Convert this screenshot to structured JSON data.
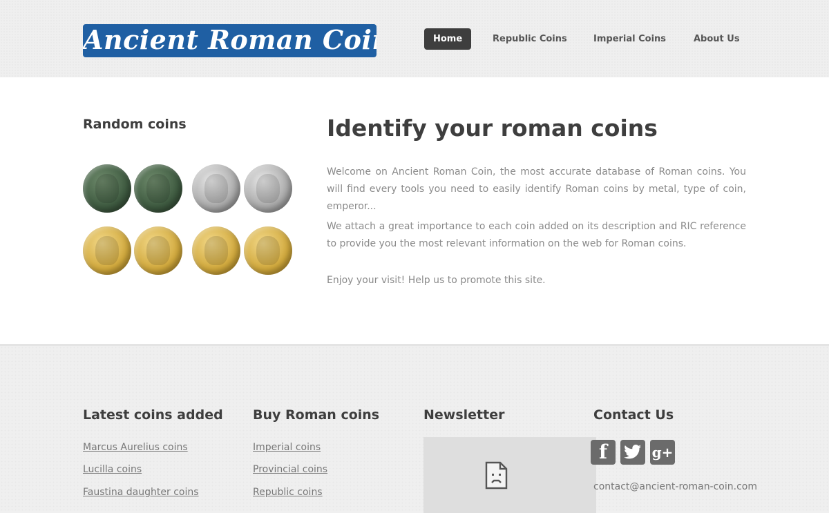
{
  "header": {
    "logo_text": "Ancient Roman Coin",
    "nav": [
      {
        "label": "Home",
        "active": true
      },
      {
        "label": "Republic Coins",
        "active": false
      },
      {
        "label": "Imperial Coins",
        "active": false
      },
      {
        "label": "About Us",
        "active": false
      }
    ]
  },
  "sidebar": {
    "title": "Random coins",
    "coins": [
      {
        "metal": "bronze"
      },
      {
        "metal": "bronze"
      },
      {
        "metal": "silver"
      },
      {
        "metal": "silver"
      },
      {
        "metal": "gold"
      },
      {
        "metal": "gold"
      },
      {
        "metal": "gold"
      },
      {
        "metal": "gold"
      }
    ]
  },
  "content": {
    "title": "Identify your roman coins",
    "paragraphs": [
      "Welcome on Ancient Roman Coin, the most accurate database of Roman coins. You will find every tools you need to easily identify Roman coins by metal, type of coin, emperor...",
      "We attach a great importance to each coin added on its description and RIC reference to provide you the most relevant information on the web for Roman coins.",
      "Enjoy your visit! Help us to promote this site."
    ]
  },
  "footer": {
    "latest": {
      "title": "Latest coins added",
      "links": [
        "Marcus Aurelius coins",
        "Lucilla coins",
        "Faustina daughter coins"
      ]
    },
    "buy": {
      "title": "Buy Roman coins",
      "links": [
        "Imperial coins",
        "Provincial coins",
        "Republic coins"
      ]
    },
    "newsletter": {
      "title": "Newsletter",
      "frame_icon": "broken-document-icon"
    },
    "contact": {
      "title": "Contact Us",
      "social": [
        {
          "icon": "facebook-icon",
          "glyph": "f"
        },
        {
          "icon": "twitter-icon",
          "glyph": ""
        },
        {
          "icon": "google-plus-icon",
          "glyph": "g+"
        }
      ],
      "email": "contact@ancient-roman-coin.com"
    }
  },
  "colors": {
    "logo_bg": "#1f5fa3",
    "nav_active_bg": "#3e3e3e",
    "text_dark": "#3e3e3e",
    "text_light": "#8a8a8a",
    "social_bg": "#6b6b6b"
  }
}
